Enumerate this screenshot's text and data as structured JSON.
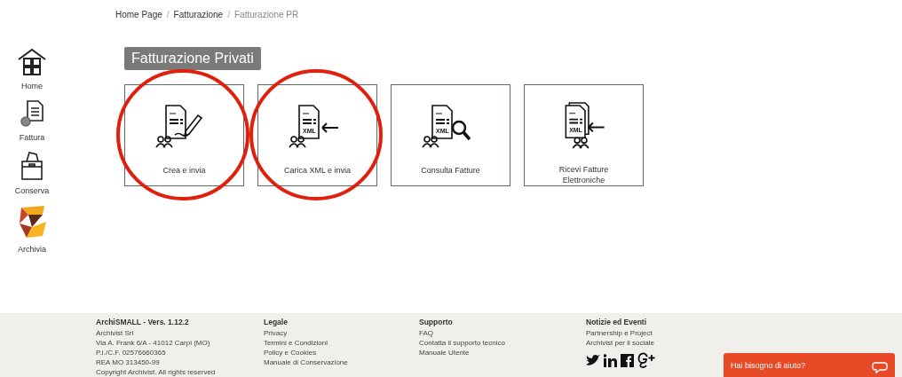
{
  "breadcrumb": {
    "separator": "/",
    "items": [
      {
        "label": "Home Page",
        "current": false
      },
      {
        "label": "Fatturazione",
        "current": false
      },
      {
        "label": "Fatturazione PR",
        "current": true
      }
    ]
  },
  "sidebar": {
    "items": [
      {
        "label": "Home",
        "kind": "home"
      },
      {
        "label": "Fattura",
        "kind": "invoice"
      },
      {
        "label": "Conserva",
        "kind": "box"
      },
      {
        "label": "Archivia",
        "kind": "logo"
      }
    ]
  },
  "section_title": "Fatturazione Privati",
  "cards": [
    {
      "label": "Crea e invia",
      "kind": "pen",
      "highlighted": true
    },
    {
      "label": "Carica XML e invia",
      "kind": "upload",
      "xml_label": "XML",
      "highlighted": true
    },
    {
      "label": "Consulta Fatture",
      "kind": "search",
      "xml_label": "XML",
      "highlighted": false
    },
    {
      "label": "Ricevi Fatture Elettroniche",
      "kind": "receive",
      "xml_label": "XML",
      "highlighted": false
    }
  ],
  "footer": {
    "columns": [
      {
        "title": "ArchiSMALL - Vers. 1.12.2",
        "lines": [
          "Archivist Srl",
          "Via A. Frank 6/A - 41012 Carpi (MO)",
          "P.I./C.F. 02576660365",
          "REA MO 313450-99",
          "Copyright Archivist. All rights reserved"
        ]
      },
      {
        "title": "Legale",
        "lines": [
          "Privacy",
          "Termini e Condizioni",
          "Policy e Cookies",
          "Manuale di Conservazione"
        ]
      },
      {
        "title": "Supporto",
        "lines": [
          "FAQ",
          "Contatta il supporto tecnico",
          "Manuale Utente"
        ]
      },
      {
        "title": "Notizie ed Eventi",
        "lines": [
          "Partnership e Project",
          "Archivist per il sociale"
        ]
      }
    ]
  },
  "help_button": {
    "label": "Hai bisogno di aiuto?"
  }
}
